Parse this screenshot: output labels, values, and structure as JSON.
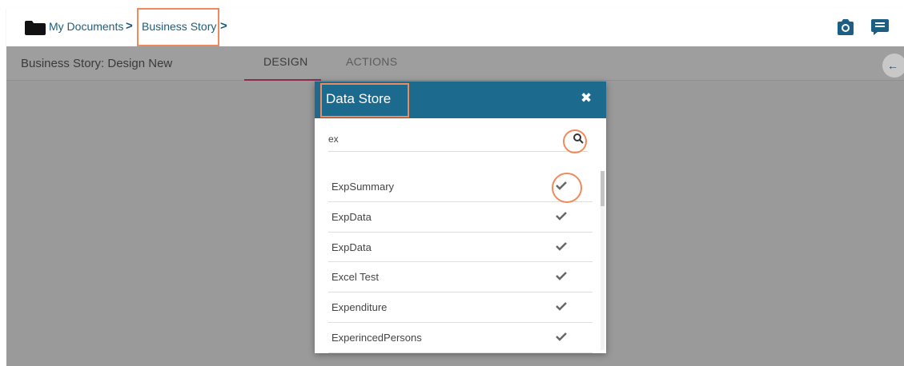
{
  "breadcrumb": {
    "root": "My Documents",
    "current": "Business Story",
    "separator": ">"
  },
  "header_icons": [
    "camera-icon",
    "comment-icon"
  ],
  "subheader": {
    "story_title": "Business Story: Design New",
    "tabs": [
      {
        "label": "DESIGN",
        "active": true
      },
      {
        "label": "ACTIONS",
        "active": false
      }
    ]
  },
  "modal": {
    "title": "Data Store",
    "close_label": "✖",
    "search": {
      "value": "ex",
      "placeholder": ""
    },
    "items": [
      {
        "label": "ExpSummary"
      },
      {
        "label": "ExpData"
      },
      {
        "label": "ExpData"
      },
      {
        "label": "Excel Test"
      },
      {
        "label": "Expenditure"
      },
      {
        "label": "ExperincedPersons"
      }
    ]
  },
  "colors": {
    "header_bg": "#1d6a8f",
    "highlight": "#ef8a5c",
    "overlay": "#9a9a9a",
    "link": "#1f5c7a"
  }
}
